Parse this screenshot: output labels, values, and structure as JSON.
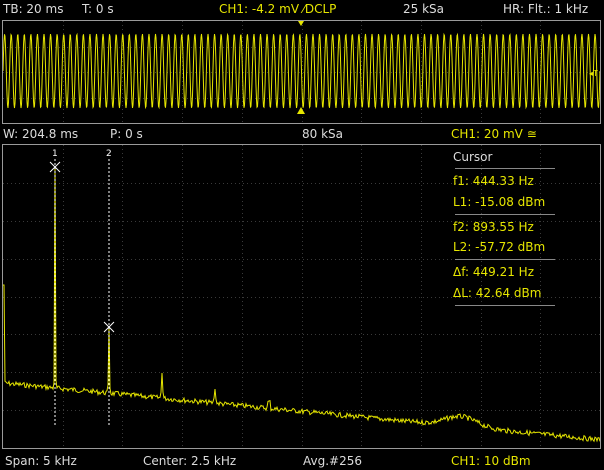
{
  "top_bar": {
    "timebase": "TB: 20 ms",
    "trigger_time": "T: 0 s",
    "channel": "CH1: -4.2 mV ⁄DCLP",
    "sample_rate": "25 kSa",
    "hr_filter": "HR: Flt.: 1 kHz"
  },
  "mid_bar": {
    "window": "W: 204.8 ms",
    "position": "P: 0 s",
    "sample_rate": "80 kSa",
    "channel_scale": "CH1: 20 mV ≅"
  },
  "cursor_panel": {
    "title": "Cursor",
    "f1": "f1: 444.33 Hz",
    "l1": "L1: -15.08 dBm",
    "f2": "f2: 893.55 Hz",
    "l2": "L2: -57.72 dBm",
    "df": "Δf: 449.21 Hz",
    "dl": "ΔL: 42.64 dBm"
  },
  "cursors": [
    {
      "label": "1",
      "frequency_hz": 444.33,
      "level_dbm": -15.08
    },
    {
      "label": "2",
      "frequency_hz": 893.55,
      "level_dbm": -57.72
    }
  ],
  "bottom_bar": {
    "span": "Span: 5 kHz",
    "center": "Center: 2.5 kHz",
    "averaging": "Avg.#256",
    "channel_ref": "CH1: 10 dBm"
  },
  "colors": {
    "trace": "#e6e600",
    "grid": "#3a3a3a",
    "border": "#9a9a9a",
    "cursor_line": "#ffffff"
  }
}
